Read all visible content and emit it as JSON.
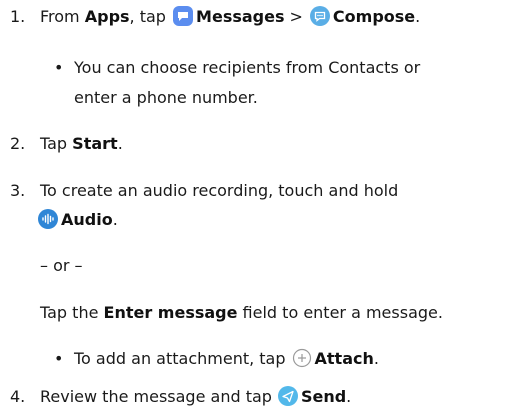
{
  "steps": {
    "s1": {
      "num": "1.",
      "pre": "From ",
      "apps": "Apps",
      "comma_tap": ", tap",
      "messages": "Messages",
      "sep": ">",
      "compose": "Compose",
      "end": "."
    },
    "b1": {
      "line1": "You can choose recipients from Contacts or",
      "line2": "enter a phone number."
    },
    "s2": {
      "num": "2.",
      "pre": "Tap ",
      "start": "Start",
      "end": "."
    },
    "s3": {
      "num": "3.",
      "line1": "To create an audio recording, touch and hold",
      "audio": "Audio",
      "end": "."
    },
    "or": "– or –",
    "enter": {
      "pre": "Tap the ",
      "field": "Enter message",
      "post": " field to enter a message."
    },
    "b2": {
      "pre": "To add an attachment, tap",
      "attach": "Attach",
      "end": "."
    },
    "s4": {
      "num": "4.",
      "pre": "Review the message and tap",
      "send": "Send",
      "end": "."
    }
  },
  "icons": {
    "messages": "messages-app-icon",
    "compose": "compose-icon",
    "audio": "audio-waveform-icon",
    "attach": "plus-circle-icon",
    "send": "send-icon"
  },
  "colors": {
    "messages_icon": "#5b8def",
    "compose_icon": "#5aaee6",
    "audio_icon": "#2f86d6",
    "send_icon": "#52b8ea",
    "attach_icon": "#9a9a9a"
  }
}
